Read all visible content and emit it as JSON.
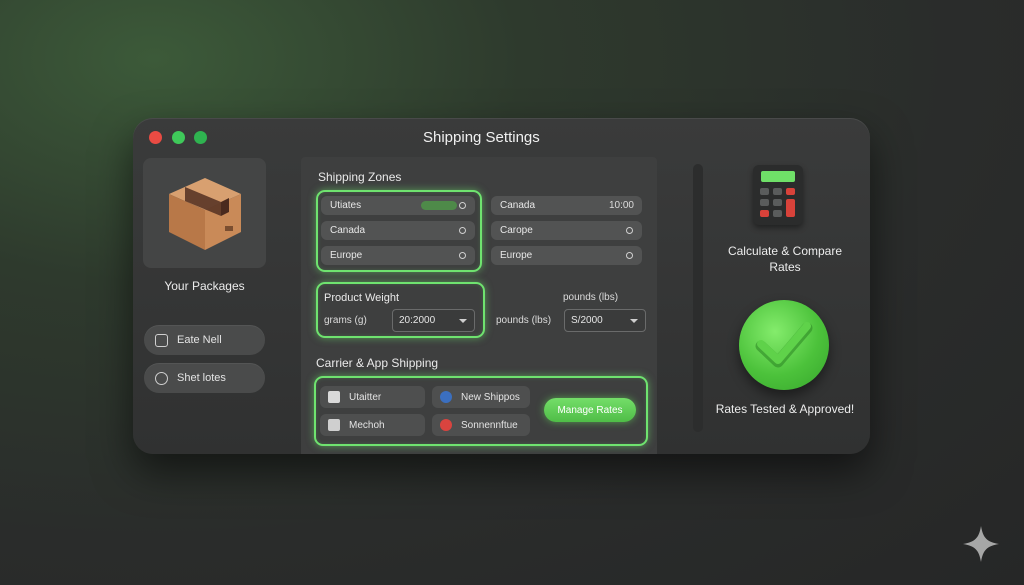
{
  "window": {
    "title": "Shipping Settings"
  },
  "sidebar": {
    "packages_label": "Your Packages",
    "buttons": [
      {
        "label": "Eate Nell",
        "icon": "edit-icon"
      },
      {
        "label": "Shet lotes",
        "icon": "notes-icon"
      }
    ]
  },
  "zones": {
    "title": "Shipping Zones",
    "left": [
      "Utiates",
      "Canada",
      "Europe"
    ],
    "right": [
      {
        "label": "Canada",
        "value": "10:00"
      },
      {
        "label": "Carope",
        "value": ""
      },
      {
        "label": "Europe",
        "value": ""
      }
    ]
  },
  "weight": {
    "title": "Product Weight",
    "unit_left": "grams (g)",
    "value_left": "20:2000",
    "unit_right_header": "pounds (lbs)",
    "unit_right": "pounds (lbs)",
    "value_right": "S/2000"
  },
  "carriers": {
    "title": "Carrier & App Shipping",
    "items": [
      "Utaitter",
      "New Shippos",
      "Mechoh",
      "Sonnennftue"
    ],
    "manage_label": "Manage Rates"
  },
  "right": {
    "calc_label": "Calculate & Compare Rates",
    "approved_label": "Rates Tested & Approved!"
  },
  "colors": {
    "accent": "#6fe36f",
    "bg": "#2a2c2b",
    "window": "#343535"
  }
}
